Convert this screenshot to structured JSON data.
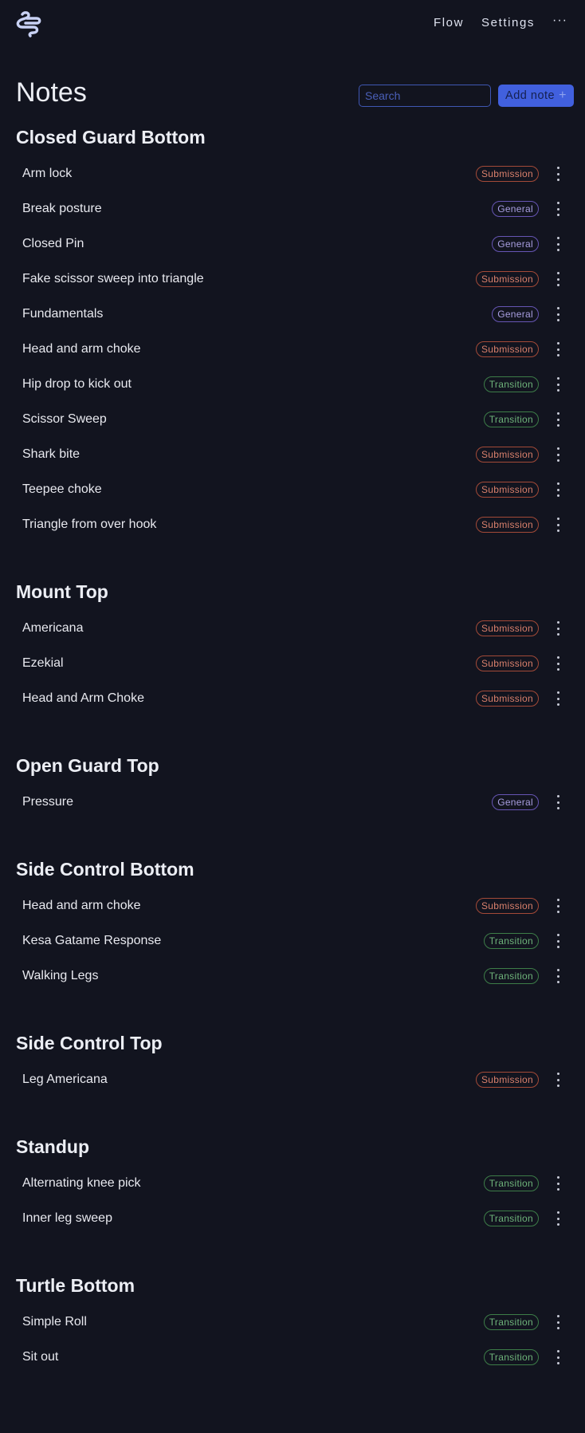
{
  "header": {
    "logo_icon": "wind-icon",
    "nav": [
      {
        "label": "Flow"
      },
      {
        "label": "Settings"
      }
    ],
    "more_label": "···"
  },
  "page": {
    "title": "Notes",
    "search_placeholder": "Search",
    "search_value": "",
    "add_note_label": "Add note",
    "add_note_icon": "+"
  },
  "colors": {
    "background": "#12141f",
    "accent": "#4160de",
    "submission": "#d9806c",
    "general": "#a89ee0",
    "transition": "#6eb37a"
  },
  "sections": [
    {
      "title": "Closed Guard Bottom",
      "notes": [
        {
          "title": "Arm lock",
          "tag": "Submission",
          "type": "submission"
        },
        {
          "title": "Break posture",
          "tag": "General",
          "type": "general"
        },
        {
          "title": "Closed Pin",
          "tag": "General",
          "type": "general"
        },
        {
          "title": "Fake scissor sweep into triangle",
          "tag": "Submission",
          "type": "submission"
        },
        {
          "title": "Fundamentals",
          "tag": "General",
          "type": "general"
        },
        {
          "title": "Head and arm choke",
          "tag": "Submission",
          "type": "submission"
        },
        {
          "title": "Hip drop to kick out",
          "tag": "Transition",
          "type": "transition"
        },
        {
          "title": "Scissor Sweep",
          "tag": "Transition",
          "type": "transition"
        },
        {
          "title": "Shark bite",
          "tag": "Submission",
          "type": "submission"
        },
        {
          "title": "Teepee choke",
          "tag": "Submission",
          "type": "submission"
        },
        {
          "title": "Triangle from over hook",
          "tag": "Submission",
          "type": "submission"
        }
      ]
    },
    {
      "title": "Mount Top",
      "notes": [
        {
          "title": "Americana",
          "tag": "Submission",
          "type": "submission"
        },
        {
          "title": "Ezekial",
          "tag": "Submission",
          "type": "submission"
        },
        {
          "title": "Head and Arm Choke",
          "tag": "Submission",
          "type": "submission"
        }
      ]
    },
    {
      "title": "Open Guard Top",
      "notes": [
        {
          "title": "Pressure",
          "tag": "General",
          "type": "general"
        }
      ]
    },
    {
      "title": "Side Control Bottom",
      "notes": [
        {
          "title": "Head and arm choke",
          "tag": "Submission",
          "type": "submission"
        },
        {
          "title": "Kesa Gatame Response",
          "tag": "Transition",
          "type": "transition"
        },
        {
          "title": "Walking Legs",
          "tag": "Transition",
          "type": "transition"
        }
      ]
    },
    {
      "title": "Side Control Top",
      "notes": [
        {
          "title": "Leg Americana",
          "tag": "Submission",
          "type": "submission"
        }
      ]
    },
    {
      "title": "Standup",
      "notes": [
        {
          "title": "Alternating knee pick",
          "tag": "Transition",
          "type": "transition"
        },
        {
          "title": "Inner leg sweep",
          "tag": "Transition",
          "type": "transition"
        }
      ]
    },
    {
      "title": "Turtle Bottom",
      "notes": [
        {
          "title": "Simple Roll",
          "tag": "Transition",
          "type": "transition"
        },
        {
          "title": "Sit out",
          "tag": "Transition",
          "type": "transition"
        }
      ]
    }
  ]
}
